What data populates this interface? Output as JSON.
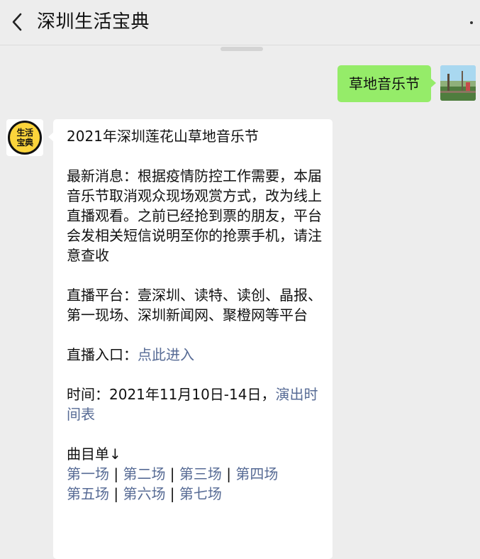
{
  "header": {
    "title": "深圳生活宝典",
    "back_icon": "chevron-left-icon",
    "more_icon": "more-dots-icon"
  },
  "colors": {
    "background": "#ededed",
    "bubble_out": "#95ec69",
    "bubble_in": "#ffffff",
    "link": "#576b95"
  },
  "messages": {
    "outgoing": {
      "text": "草地音乐节"
    },
    "incoming": {
      "avatar_line1": "生活",
      "avatar_line2": "宝典",
      "title": "2021年深圳莲花山草地音乐节",
      "news": "最新消息：根据疫情防控工作需要，本届音乐节取消观众现场观赏方式，改为线上直播观看。之前已经抢到票的朋友，平台会发相关短信说明至你的抢票手机，请注意查收",
      "platform": "直播平台：壹深圳、读特、读创、晶报、第一现场、深圳新闻网、聚橙网等平台",
      "entry_label": "直播入口：",
      "entry_link": "点此进入",
      "time_label": "时间：2021年11月10日-14日，",
      "time_link": "演出时间表",
      "playlist_label": "曲目单↓",
      "sessions": [
        "第一场",
        "第二场",
        "第三场",
        "第四场",
        "第五场",
        "第六场",
        "第七场"
      ],
      "separator": " | "
    }
  }
}
